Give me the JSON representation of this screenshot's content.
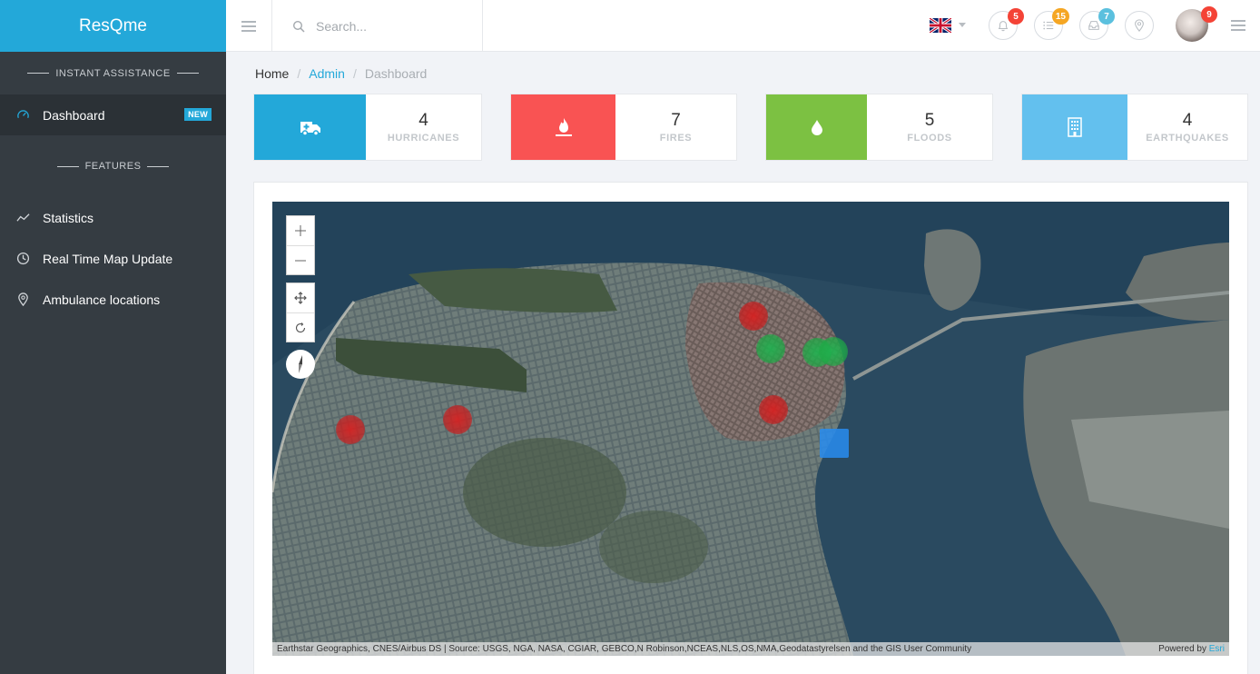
{
  "app": {
    "brand": "ResQme"
  },
  "sidebar": {
    "section_instant": "INSTANT ASSISTANCE",
    "section_features": "FEATURES",
    "items": [
      {
        "label": "Dashboard",
        "icon": "dashboard-icon",
        "badge": "NEW",
        "active": true
      },
      {
        "label": "Statistics",
        "icon": "chart-line-icon"
      },
      {
        "label": "Real Time Map Update",
        "icon": "clock-icon"
      },
      {
        "label": "Ambulance locations",
        "icon": "map-pin-icon"
      }
    ]
  },
  "topbar": {
    "search_placeholder": "Search...",
    "language": "en-GB",
    "notifications": {
      "icon": "bell-icon",
      "count": "5",
      "color": "#f44336"
    },
    "tasks": {
      "icon": "list-icon",
      "count": "15",
      "color": "#f5a623"
    },
    "messages": {
      "icon": "inbox-icon",
      "count": "7",
      "color": "#5bc0de"
    },
    "location": {
      "icon": "map-pin-icon"
    },
    "profile": {
      "count": "9",
      "color": "#f44336"
    }
  },
  "breadcrumb": {
    "home": "Home",
    "admin": "Admin",
    "current": "Dashboard"
  },
  "stats": [
    {
      "value": "4",
      "label": "HURRICANES",
      "color": "#23a8d9",
      "icon": "ambulance-icon"
    },
    {
      "value": "7",
      "label": "FIRES",
      "color": "#f95353",
      "icon": "fire-icon"
    },
    {
      "value": "5",
      "label": "FLOODS",
      "color": "#7cc142",
      "icon": "water-drop-icon"
    },
    {
      "value": "4",
      "label": "EARTHQUAKES",
      "color": "#63c0ee",
      "icon": "building-icon"
    }
  ],
  "map": {
    "attribution": "Earthstar Geographics, CNES/Airbus DS | Source: USGS, NGA, NASA, CGIAR, GEBCO,N Robinson,NCEAS,NLS,OS,NMA,Geodatastyrelsen and the GIS User Community",
    "powered_prefix": "Powered by",
    "powered_by": "Esri"
  }
}
